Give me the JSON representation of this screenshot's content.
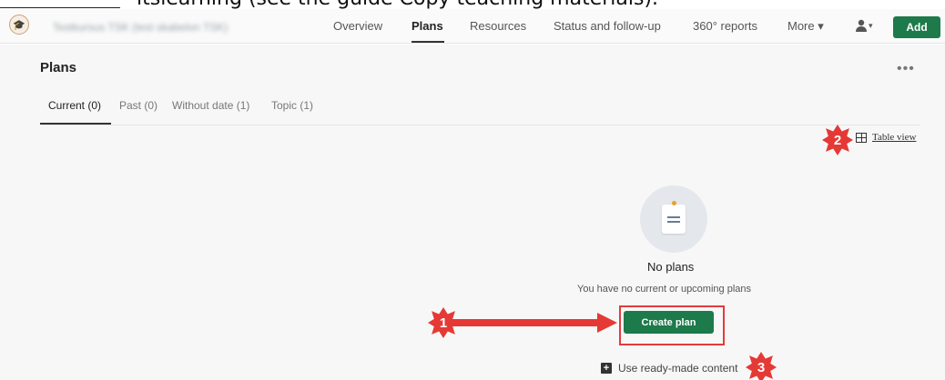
{
  "caption_fragment": "itslearning (see the guide Copy teaching materials).",
  "header": {
    "course_title": "Testkursus TSK (test skabelon TSK)",
    "nav": [
      "Overview",
      "Plans",
      "Resources",
      "Status and follow-up",
      "360° reports",
      "More ▾"
    ],
    "active_nav": "Plans",
    "user_menu_caret": "▾",
    "add_label": "Add"
  },
  "page": {
    "title": "Plans",
    "more_options": "•••",
    "tabs": [
      "Current (0)",
      "Past (0)",
      "Without date (1)",
      "Topic (1)"
    ],
    "active_tab": "Current (0)",
    "table_view_label": "Table view"
  },
  "empty_state": {
    "heading": "No plans",
    "message": "You have no current or upcoming plans",
    "create_label": "Create plan",
    "ready_made_label": "Use ready-made content"
  },
  "annotations": {
    "badges": [
      "1",
      "2",
      "3"
    ]
  },
  "colors": {
    "accent_green": "#1d7a4b",
    "annotation_red": "#e53935"
  },
  "icons": {
    "logo": "course-logo-icon",
    "user": "user-icon",
    "table": "table-icon",
    "plus": "plus-box-icon"
  }
}
